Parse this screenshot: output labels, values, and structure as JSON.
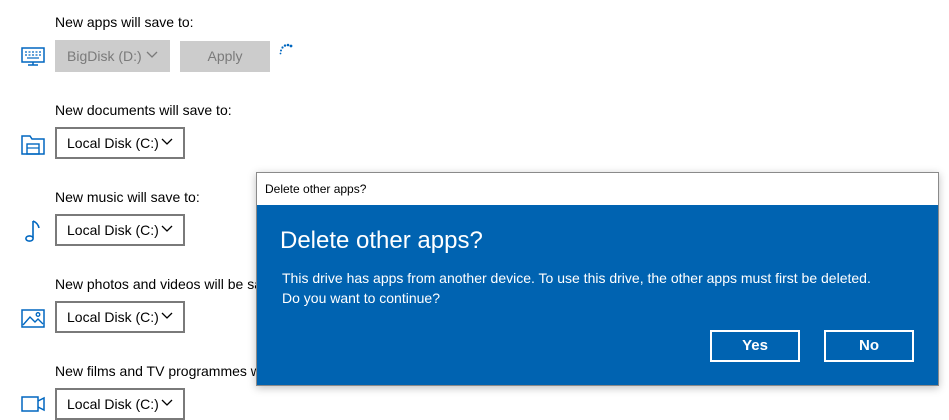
{
  "sections": [
    {
      "label": "New apps will save to:",
      "value": "BigDisk (D:)",
      "icon": "monitor-icon"
    },
    {
      "label": "New documents will save to:",
      "value": "Local Disk (C:)",
      "icon": "folder-icon"
    },
    {
      "label": "New music will save to:",
      "value": "Local Disk (C:)",
      "icon": "music-note-icon"
    },
    {
      "label": "New photos and videos will be sa",
      "value": "Local Disk (C:)",
      "icon": "photo-icon"
    },
    {
      "label": "New films and TV programmes w",
      "value": "Local Disk (C:)",
      "icon": "video-icon"
    }
  ],
  "apply_label": "Apply",
  "dialog": {
    "title": "Delete other apps?",
    "heading": "Delete other apps?",
    "message_line1": "This drive has apps from another device. To use this drive, the other apps must first be deleted.",
    "message_line2": "Do you want to continue?",
    "yes_label": "Yes",
    "no_label": "No"
  },
  "colors": {
    "accent": "#0063b1",
    "disabled": "#cccccc",
    "icon_blue": "#0067c0"
  }
}
